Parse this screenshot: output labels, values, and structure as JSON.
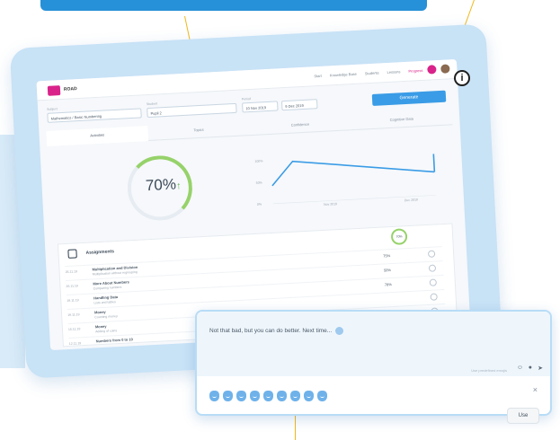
{
  "app": {
    "brand": "ROAD",
    "nav": [
      "Start",
      "Knowledge Base",
      "Students",
      "Lessons",
      "Progress"
    ]
  },
  "filters": {
    "subject_label": "Subject",
    "subject_value": "Mathematics / Basic Numbering",
    "student_label": "Student",
    "student_value": "Pupil 2",
    "period_label": "Period",
    "date_from": "10 Nov 2019",
    "date_to": "9 Dec 2019",
    "generate": "Generate"
  },
  "tabs": [
    "Activities",
    "Topics",
    "Confidence",
    "Cognitive Data"
  ],
  "progress": {
    "percent": 70,
    "percent_text": "70%",
    "trend": "↑"
  },
  "graph": {
    "y_labels": [
      "100%",
      "50%",
      "0%"
    ],
    "x_labels": [
      "Nov 2019",
      "Dec 2019"
    ]
  },
  "assignments": {
    "title": "Assignments",
    "overall": "70%",
    "rows": [
      {
        "date": "26.11.19",
        "name": "Multiplication and Division",
        "sub": "Multiplication without regrouping",
        "pct": "75%"
      },
      {
        "date": "26.11.19",
        "name": "More About Numbers",
        "sub": "Comparing numbers",
        "pct": "50%"
      },
      {
        "date": "19.11.19",
        "name": "Handling Data",
        "sub": "Lists and tables",
        "pct": "78%"
      },
      {
        "date": "19.11.19",
        "name": "Money",
        "sub": "Counting money",
        "pct": ""
      },
      {
        "date": "15.11.19",
        "name": "Money",
        "sub": "Adding of coins",
        "pct": ""
      },
      {
        "date": "12.11.19",
        "name": "Numbers from 0 to 10",
        "sub": "",
        "pct": ""
      }
    ]
  },
  "chat": {
    "message": "Not that bad, but you can do better. Next time...",
    "hint": "Use predefined emojis",
    "close": "×",
    "use_label": "Use",
    "emojis": [
      "student-icon",
      "girl-icon",
      "smile-icon",
      "book-icon",
      "medal-icon",
      "thumb-icon",
      "car-icon",
      "handshake-icon",
      "graduation-icon"
    ]
  },
  "info_icon": "i",
  "colors": {
    "accent_blue": "#3a9ce6",
    "brand_pink": "#d9238a",
    "progress_green": "#96d26a",
    "callout_yellow": "#f2b719",
    "tablet_blue": "#c8e2f6"
  }
}
